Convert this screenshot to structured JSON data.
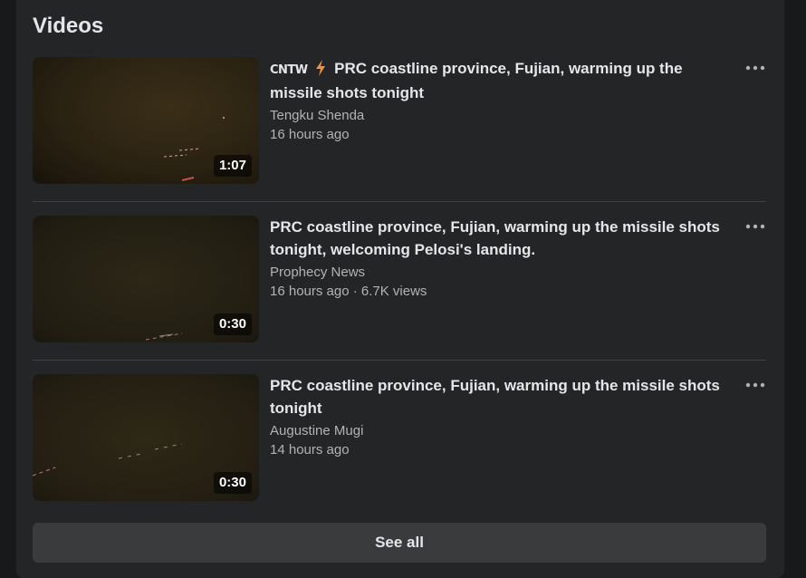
{
  "section": {
    "title": "Videos",
    "see_all_label": "See all"
  },
  "colors": {
    "background": "#18191a",
    "card": "#242526",
    "primary_text": "#e4e6eb",
    "secondary_text": "#b0b3b8",
    "accent_bolt": "#f7923a",
    "button": "#3a3b3c"
  },
  "videos": [
    {
      "badge_logo": "CNTW",
      "badge_icon": "lightning-bolt-icon",
      "title": "PRC coastline province, Fujian, warming up the missile shots tonight",
      "author": "Tengku Shenda",
      "meta": "16 hours ago",
      "duration": "1:07",
      "more_icon": "more-options-icon"
    },
    {
      "title": "PRC coastline province, Fujian, warming up the missile shots tonight, welcoming Pelosi's landing.",
      "author": "Prophecy News",
      "meta": "16 hours ago · 6.7K views",
      "duration": "0:30",
      "more_icon": "more-options-icon"
    },
    {
      "title": "PRC coastline province, Fujian, warming up the missile shots tonight",
      "author": "Augustine Mugi",
      "meta": "14 hours ago",
      "duration": "0:30",
      "more_icon": "more-options-icon"
    }
  ]
}
